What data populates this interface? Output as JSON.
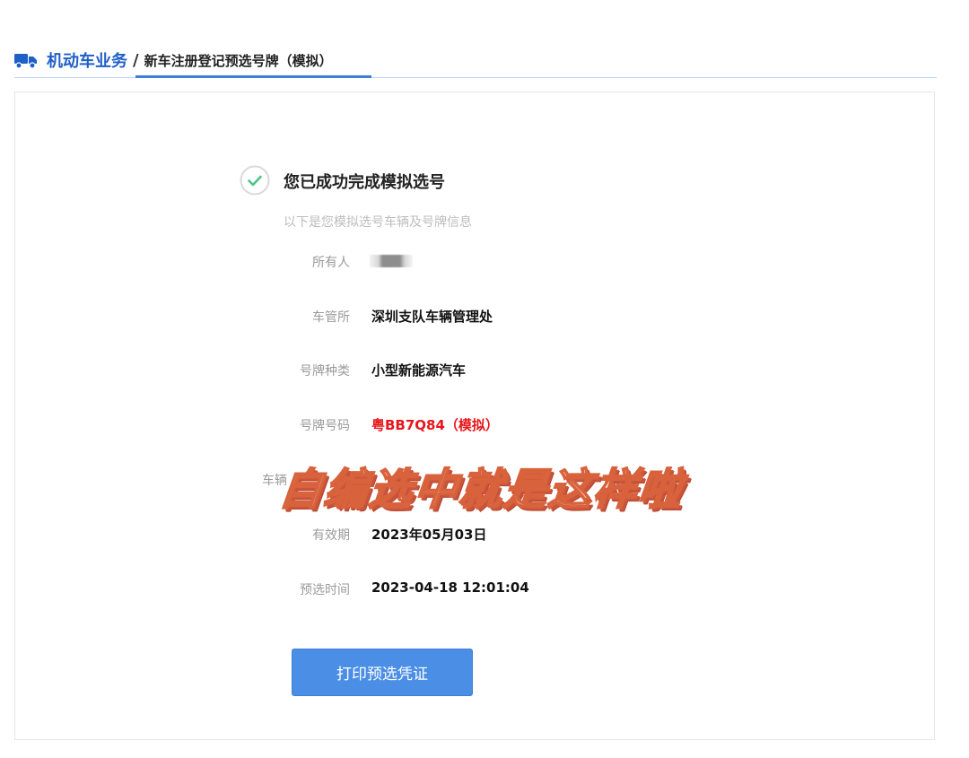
{
  "breadcrumb": {
    "root": "机动车业务",
    "separator": "/",
    "current": "新车注册登记预选号牌（模拟）"
  },
  "result": {
    "title": "您已成功完成模拟选号",
    "subtitle": "以下是您模拟选号车辆及号牌信息",
    "rows": [
      {
        "label": "所有人",
        "value": ""
      },
      {
        "label": "车管所",
        "value": "深圳支队车辆管理处"
      },
      {
        "label": "号牌种类",
        "value": "小型新能源汽车"
      },
      {
        "label": "号牌号码",
        "value": "粤BB7Q84（模拟）"
      },
      {
        "label": "车辆",
        "value": ""
      },
      {
        "label": "有效期",
        "value": "2023年05月03日"
      },
      {
        "label": "预选时间",
        "value": "2023-04-18 12:01:04"
      }
    ]
  },
  "actions": {
    "print_label": "打印预选凭证"
  },
  "overlay": {
    "caption": "自编选中就是这样啦"
  },
  "colors": {
    "accent": "#4b8ee6",
    "link": "#1f5fc8",
    "plate_red": "#e8161b",
    "success_green": "#4cc38a"
  },
  "icons": {
    "breadcrumb": "truck-icon",
    "success": "check-circle-icon"
  }
}
